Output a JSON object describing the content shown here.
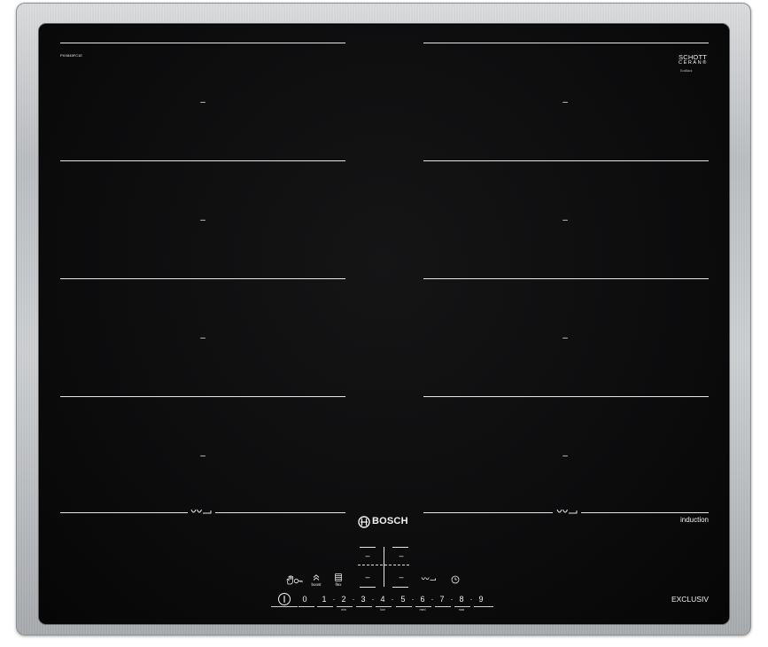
{
  "cooktop": {
    "model_code": "PXX645FC1E",
    "glass_brand": "SCHOTT",
    "glass_product": "CERAN®",
    "glass_subline": "EcoBlack",
    "brand": "BOSCH",
    "technology": "induction",
    "series": "EXCLUSIV"
  },
  "zones": {
    "left": [
      {
        "display": "–"
      },
      {
        "display": "–"
      },
      {
        "display": "–"
      },
      {
        "display": "–"
      }
    ],
    "right": [
      {
        "display": "–"
      },
      {
        "display": "–"
      },
      {
        "display": "–"
      },
      {
        "display": "–"
      }
    ]
  },
  "controls": {
    "boost_label": "boost",
    "flex_label": "flex",
    "display": {
      "top_left": "–",
      "top_right": "–",
      "bottom_left": "–",
      "bottom_right": "–"
    },
    "levels": [
      "0",
      "1",
      "2",
      "3",
      "4",
      "5",
      "6",
      "7",
      "8",
      "9"
    ],
    "level_separator": "·",
    "level_marks": {
      "2": "min",
      "4": "low",
      "6": "med",
      "8": "max"
    }
  },
  "icons": [
    "pan-size-icon",
    "bosch-logo-icon",
    "wipe-protection-icon",
    "boost-icon",
    "flex-icon",
    "frying-sensor-icon",
    "timer-clock-icon",
    "power-icon"
  ],
  "colors": {
    "glass": "#0b0b0c",
    "frame": "#babdc0",
    "print": "#f2f2f2"
  }
}
